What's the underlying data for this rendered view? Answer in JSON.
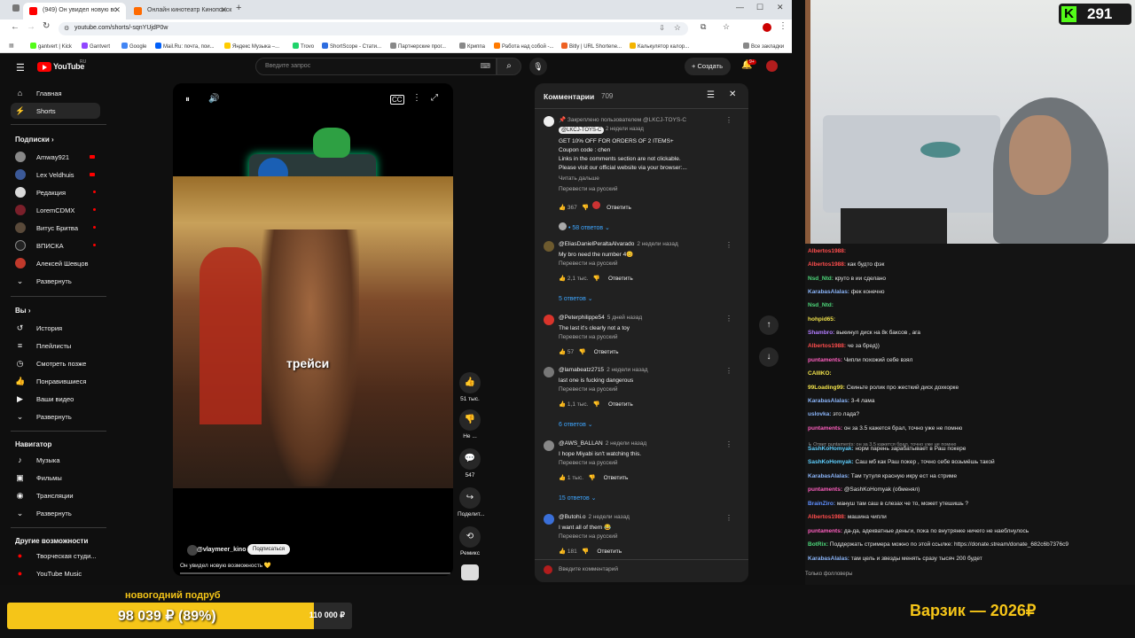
{
  "browser": {
    "tabs": [
      {
        "label": "(949) Он увидел новую во",
        "active": true
      },
      {
        "label": "Онлайн кинотеатр Кинопоиск",
        "active": false
      }
    ],
    "url": "youtube.com/shorts/-sqnYUjdP0w",
    "bookmarks": [
      "gantvert | Kick",
      "Gantvert",
      "Google",
      "Mail.Ru: почта, пои...",
      "Яндекс Музыка –...",
      "Trovo",
      "ShortScope - Стати...",
      "Партнерские прог...",
      "Криппа",
      "Работа над собой -...",
      "Bitly | URL Shortene...",
      "Калькулятор калор..."
    ],
    "bookmarks_all": "Все закладки"
  },
  "youtube": {
    "logo": "YouTube",
    "logo_region": "RU",
    "search_placeholder": "Введите запрос",
    "create_label": "Создать",
    "notif_badge": "9+",
    "sidebar": {
      "main": [
        {
          "label": "Главная",
          "icon": "home-icon"
        },
        {
          "label": "Shorts",
          "icon": "shorts-icon"
        }
      ],
      "subs_title": "Подписки",
      "subs": [
        {
          "label": "Amway921",
          "live": true
        },
        {
          "label": "Lex Veldhuis",
          "live": true
        },
        {
          "label": "Редакция",
          "live": true
        },
        {
          "label": "LoremCDMX",
          "live": true
        },
        {
          "label": "Витус Бритва",
          "live": true
        },
        {
          "label": "ВПИСКА",
          "live": true
        },
        {
          "label": "Алексей Шевцов",
          "live": false
        }
      ],
      "expand_label": "Развернуть",
      "you_title": "Вы",
      "you": [
        {
          "label": "История",
          "icon": "history-icon"
        },
        {
          "label": "Плейлисты",
          "icon": "playlist-icon"
        },
        {
          "label": "Смотреть позже",
          "icon": "clock-icon"
        },
        {
          "label": "Понравившиеся",
          "icon": "like-icon"
        },
        {
          "label": "Ваши видео",
          "icon": "video-icon"
        },
        {
          "label": "Развернуть",
          "icon": "chevron-down-icon"
        }
      ],
      "nav_title": "Навигатор",
      "nav": [
        {
          "label": "Музыка",
          "icon": "music-icon"
        },
        {
          "label": "Фильмы",
          "icon": "film-icon"
        },
        {
          "label": "Трансляции",
          "icon": "live-icon"
        },
        {
          "label": "Развернуть",
          "icon": "chevron-down-icon"
        }
      ],
      "other_title": "Другие возможности",
      "other": [
        {
          "label": "Творческая студи...",
          "icon": "studio-icon"
        },
        {
          "label": "YouTube Music",
          "icon": "yt-music-icon"
        }
      ]
    },
    "short": {
      "overlay_text": "трейси",
      "channel": "@vlaymeer_kino",
      "subscribe": "Подписаться",
      "title": "Он увидел новую возможность 💛",
      "likes": "51 тыс.",
      "dislike": "Не ...",
      "comments_count": "547",
      "share": "Поделит...",
      "remix": "Ремикс"
    },
    "comments": {
      "title": "Комментарии",
      "count": "709",
      "input_placeholder": "Введите комментарий",
      "items": [
        {
          "pinned": "Закреплено пользователем @LKCJ-TOYS-C",
          "author": "@LKCJ-TOYS-C",
          "time": "2 недели назад",
          "lines": [
            "GET 10% OFF FOR ORDERS OF 2 ITEMS+",
            "Coupon code : chen",
            "Links in the comments section are not clickable.",
            "Please visit our official website via your browser:..."
          ],
          "read_more": "Читать дальше",
          "translate": "Перевести на русский",
          "likes": "367",
          "reply": "Ответить",
          "replies": "• 58 ответов"
        },
        {
          "author": "@EliasDanielPeraltaAlvarado",
          "time": "2 недели назад",
          "lines": [
            "My bro need the number 4😊"
          ],
          "translate": "Перевести на русский",
          "likes": "2,1 тыс.",
          "reply": "Ответить",
          "replies": "5 ответов"
        },
        {
          "author": "@Peterphilippe54",
          "time": "5 дней назад",
          "lines": [
            "The last it's clearly not a toy"
          ],
          "translate": "Перевести на русский",
          "likes": "57",
          "reply": "Ответить",
          "replies": ""
        },
        {
          "author": "@lamabeatz2715",
          "time": "2 недели назад",
          "lines": [
            "last one is fucking dangerous"
          ],
          "translate": "Перевести на русский",
          "likes": "1,1 тыс.",
          "reply": "Ответить",
          "replies": "6 ответов"
        },
        {
          "author": "@AWS_BALLAN",
          "time": "2 недели назад",
          "lines": [
            "I hope Miyabi isn't watching this."
          ],
          "translate": "Перевести на русский",
          "likes": "1 тыс.",
          "reply": "Ответить",
          "replies": "15 ответов"
        },
        {
          "author": "@Butohi.o",
          "time": "2 недели назад",
          "lines": [
            "I want all of them 😂"
          ],
          "translate": "Перевести на русский",
          "likes": "181",
          "reply": "Ответить",
          "replies": ""
        }
      ]
    }
  },
  "stream": {
    "viewers": "291",
    "chat": [
      {
        "user": "Albertos1988:",
        "text": "",
        "color": "#ff4d4d"
      },
      {
        "user": "Albertos1988:",
        "text": "как будто фэк",
        "color": "#ff4d4d"
      },
      {
        "user": "Nsd_Ntd:",
        "text": "круто в ии сделано",
        "color": "#4dd77a"
      },
      {
        "user": "KarabasAlalas:",
        "text": "фек конечно",
        "color": "#8ab4f8"
      },
      {
        "user": "Nsd_Ntd:",
        "text": "",
        "color": "#4dd77a"
      },
      {
        "user": "hohpid65:",
        "text": "",
        "color": "#f0e14a"
      },
      {
        "user": "Shambro:",
        "text": "выкинул диск на 8к баксов , ага",
        "color": "#b27cff"
      },
      {
        "user": "Albertos1988:",
        "text": "че за бред))",
        "color": "#ff4d4d"
      },
      {
        "user": "puntaments:",
        "text": "Чипли похожий себе взял",
        "color": "#ff5fbf"
      },
      {
        "user": "CAIIIKO:",
        "text": "",
        "color": "#f0e14a"
      },
      {
        "user": "99Loading99:",
        "text": "Скиньте ролик про жесткий диск дохкорке",
        "color": "#f0e14a"
      },
      {
        "user": "KarabasAlalas:",
        "text": "3-4 лама",
        "color": "#8ab4f8"
      },
      {
        "user": "uslovka:",
        "text": "это лада?",
        "color": "#8ab4f8"
      },
      {
        "user": "puntaments:",
        "text": "он за 3.5 кажется брал, точно уже не помню",
        "color": "#ff5fbf"
      },
      {
        "user": "SashKoHomyak:",
        "text": "норм парень зарабатывает в Раш покере",
        "color": "#5fd0ff"
      },
      {
        "user": "SashKoHomyak:",
        "text": "Саш мб как Раш покер , точно себе возьмёшь такой",
        "color": "#5fd0ff"
      },
      {
        "user": "KarabasAlalas:",
        "text": "Там тутуля красную икру ест на стриме",
        "color": "#8ab4f8"
      },
      {
        "user": "puntaments:",
        "text": "@SashKoHomyak (обменял)",
        "color": "#ff5fbf"
      },
      {
        "user": "BrainZiro:",
        "text": "мануш там саш в слезах че то, может утешишь ?",
        "color": "#5f8fff"
      },
      {
        "user": "Albertos1988:",
        "text": "машина чипли",
        "color": "#ff4d4d"
      },
      {
        "user": "puntaments:",
        "text": "да-да, адекватные деньги, пока по внутрянке ничего не наеблнулось",
        "color": "#ff5fbf"
      },
      {
        "user": "BotRix:",
        "text": "Поддержать стримера можно по этой ссылке: https://donate.stream/donate_682c6b7376c9",
        "color": "#4dd77a"
      },
      {
        "user": "KarabasAlalas:",
        "text": "там цель и звезды менять сразу тысяч 200 будет",
        "color": "#8ab4f8"
      }
    ],
    "reply_hint": "↳ Ответ puntaments: он за 3.5 кажется брал, точно уже не помню",
    "followers_only": "Только фолловеры",
    "goal_title": "новогодний подруб",
    "goal_current": "98 039 ₽ (89%)",
    "goal_target": "110 000 ₽",
    "goal_fraction": 0.89,
    "banner": "Варзик — 2026₽"
  }
}
